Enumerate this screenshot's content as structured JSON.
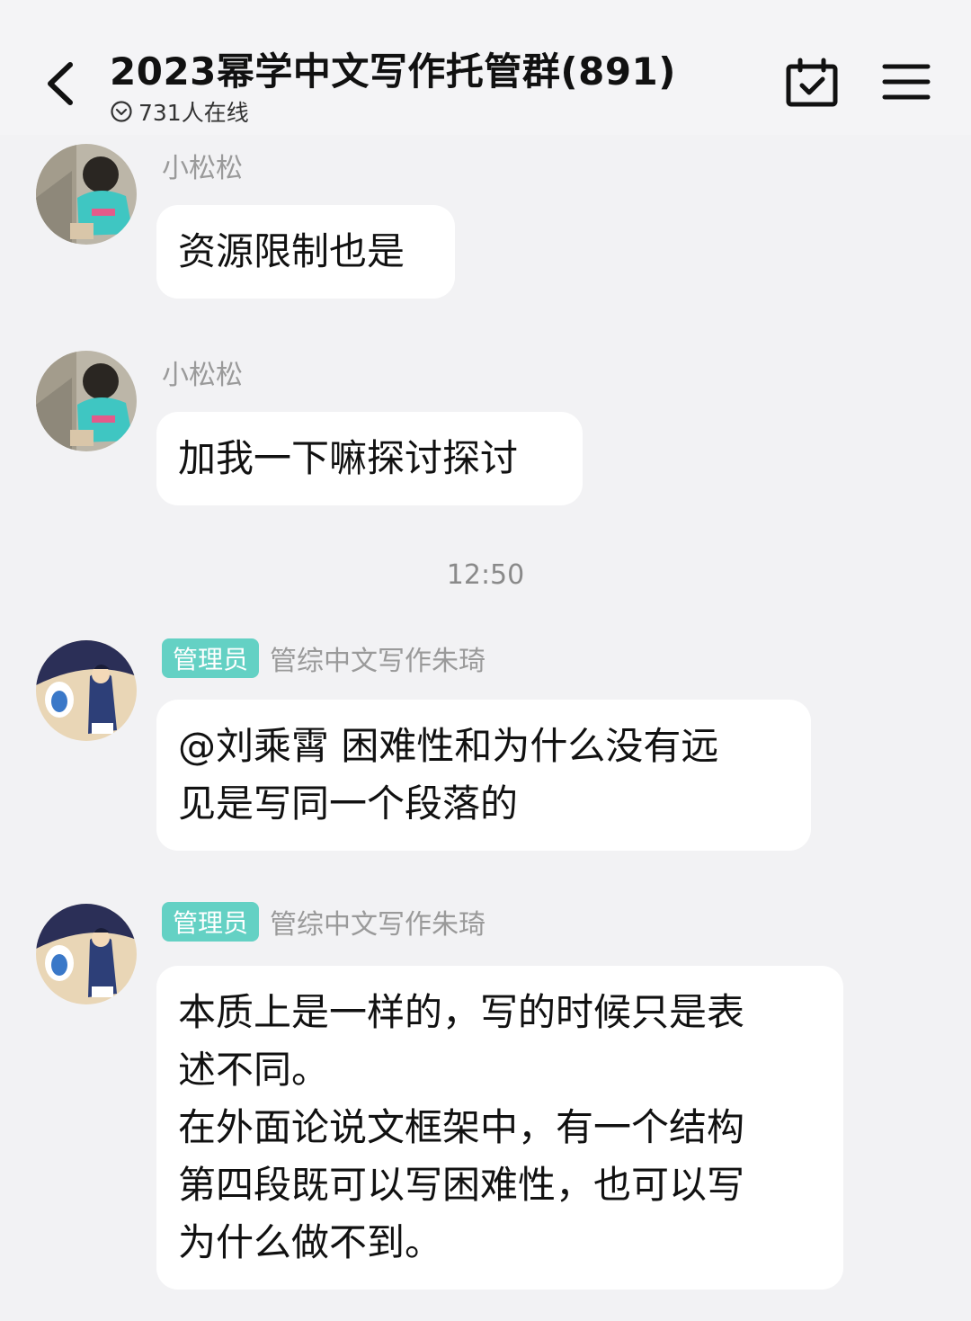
{
  "header": {
    "title": "2023幂学中文写作托管群(891)",
    "online_text": "731人在线"
  },
  "messages": [
    {
      "sender": "小松松",
      "lines": [
        "资源限制也是"
      ]
    },
    {
      "sender": "小松松",
      "lines": [
        "加我一下嘛探讨探讨"
      ]
    },
    {
      "badge": "管理员",
      "sender": "管综中文写作朱琦",
      "lines": [
        "@刘乘霄 困难性和为什么没有远",
        "见是写同一个段落的"
      ]
    },
    {
      "badge": "管理员",
      "sender": "管综中文写作朱琦",
      "lines": [
        "本质上是一样的，写的时候只是表",
        "述不同。",
        "在外面论说文框架中，有一个结构",
        "第四段既可以写困难性，也可以写",
        "为什么做不到。"
      ]
    }
  ],
  "timestamp": "12:50",
  "colors": {
    "badge": "#64d1c4",
    "bubble": "#ffffff",
    "background": "#f2f2f4",
    "sender_name": "#9a9a9a"
  },
  "icons": {
    "back": "chevron-left-icon",
    "online": "chevron-circle-icon",
    "calendar": "calendar-check-icon",
    "menu": "menu-icon"
  }
}
